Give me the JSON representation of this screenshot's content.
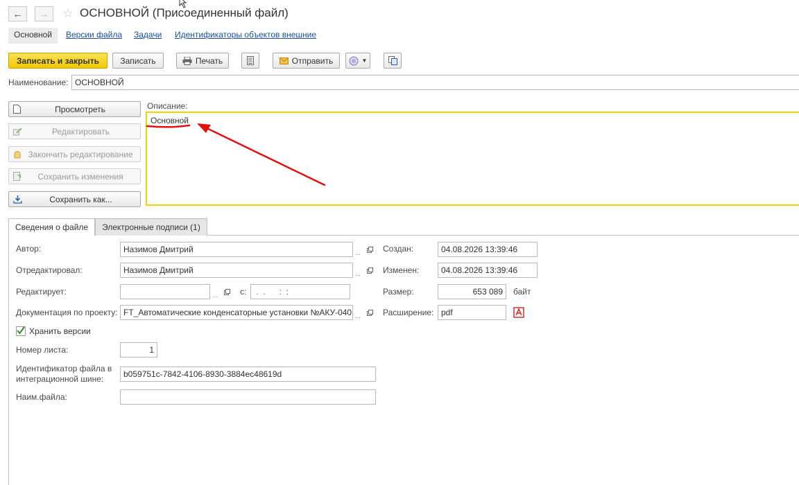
{
  "window": {
    "title": "ОСНОВНОЙ (Присоединенный файл)",
    "back_icon": "arrow-left-icon",
    "forward_icon": "arrow-right-icon",
    "favorite_icon": "star-icon"
  },
  "nav_tabs": [
    {
      "label": "Основной",
      "active": true
    },
    {
      "label": "Версии файла",
      "active": false
    },
    {
      "label": "Задачи",
      "active": false
    },
    {
      "label": "Идентификаторы объектов внешние",
      "active": false
    }
  ],
  "toolbar": {
    "save_close": "Записать и закрыть",
    "save": "Записать",
    "print": "Печать",
    "send": "Отправить"
  },
  "name_field": {
    "label": "Наименование:",
    "value": "ОСНОВНОЙ"
  },
  "file_actions": {
    "view": "Просмотреть",
    "edit": "Редактировать",
    "finish_edit": "Закончить редактирование",
    "save_changes": "Сохранить изменения",
    "save_as": "Сохранить как..."
  },
  "description": {
    "label": "Описание:",
    "value": "Основной"
  },
  "detail_tabs": [
    {
      "label": "Сведения о файле",
      "active": true
    },
    {
      "label": "Электронные подписи (1)",
      "active": false
    }
  ],
  "details": {
    "author_label": "Автор:",
    "author": "Назимов Дмитрий",
    "edited_by_label": "Отредактировал:",
    "edited_by": "Назимов Дмитрий",
    "editing_label": "Редактирует:",
    "editing": "",
    "since_label": "с:",
    "since": " .  .      :  :",
    "project_doc_label": "Документация по проекту:",
    "project_doc": "FT_Автоматические конденсаторные установки №АКУ-040",
    "keep_versions_label": "Хранить версии",
    "keep_versions": true,
    "sheet_no_label": "Номер листа:",
    "sheet_no": "1",
    "integration_id_label_1": "Идентификатор файла в",
    "integration_id_label_2": "интеграционной шине:",
    "integration_id": "b059751c-7842-4106-8930-3884ec48619d",
    "file_name_label": "Наим.файла:",
    "file_name": "",
    "created_label": "Создан:",
    "created": "04.08.2026 13:39:46",
    "modified_label": "Изменен:",
    "modified": "04.08.2026 13:39:46",
    "size_label": "Размер:",
    "size": "653 089",
    "size_unit": "байт",
    "extension_label": "Расширение:",
    "extension": "pdf"
  },
  "colors": {
    "accent_yellow": "#f2c800",
    "annotation_red": "#e01010",
    "link_blue": "#1a4f9c"
  }
}
